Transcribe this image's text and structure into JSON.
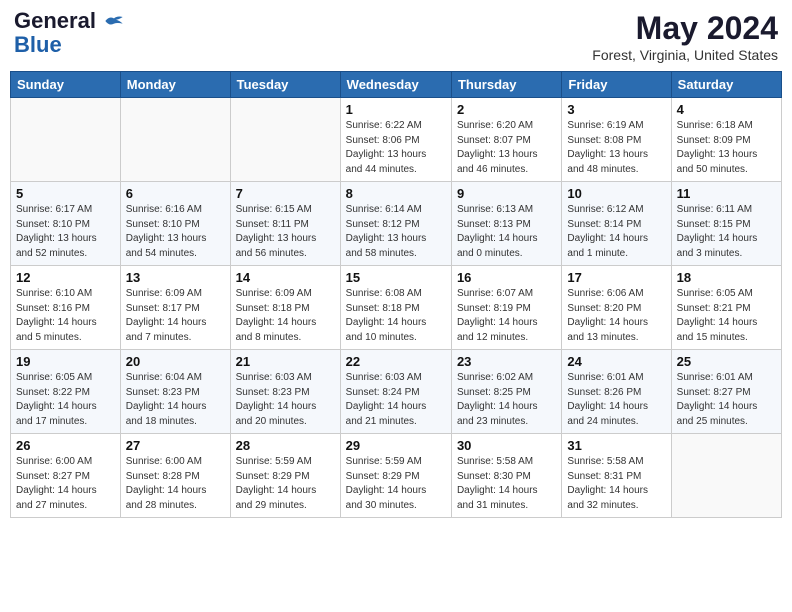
{
  "header": {
    "logo_line1": "General",
    "logo_line2": "Blue",
    "month_year": "May 2024",
    "location": "Forest, Virginia, United States"
  },
  "days_of_week": [
    "Sunday",
    "Monday",
    "Tuesday",
    "Wednesday",
    "Thursday",
    "Friday",
    "Saturday"
  ],
  "weeks": [
    [
      {
        "day": "",
        "info": ""
      },
      {
        "day": "",
        "info": ""
      },
      {
        "day": "",
        "info": ""
      },
      {
        "day": "1",
        "info": "Sunrise: 6:22 AM\nSunset: 8:06 PM\nDaylight: 13 hours\nand 44 minutes."
      },
      {
        "day": "2",
        "info": "Sunrise: 6:20 AM\nSunset: 8:07 PM\nDaylight: 13 hours\nand 46 minutes."
      },
      {
        "day": "3",
        "info": "Sunrise: 6:19 AM\nSunset: 8:08 PM\nDaylight: 13 hours\nand 48 minutes."
      },
      {
        "day": "4",
        "info": "Sunrise: 6:18 AM\nSunset: 8:09 PM\nDaylight: 13 hours\nand 50 minutes."
      }
    ],
    [
      {
        "day": "5",
        "info": "Sunrise: 6:17 AM\nSunset: 8:10 PM\nDaylight: 13 hours\nand 52 minutes."
      },
      {
        "day": "6",
        "info": "Sunrise: 6:16 AM\nSunset: 8:10 PM\nDaylight: 13 hours\nand 54 minutes."
      },
      {
        "day": "7",
        "info": "Sunrise: 6:15 AM\nSunset: 8:11 PM\nDaylight: 13 hours\nand 56 minutes."
      },
      {
        "day": "8",
        "info": "Sunrise: 6:14 AM\nSunset: 8:12 PM\nDaylight: 13 hours\nand 58 minutes."
      },
      {
        "day": "9",
        "info": "Sunrise: 6:13 AM\nSunset: 8:13 PM\nDaylight: 14 hours\nand 0 minutes."
      },
      {
        "day": "10",
        "info": "Sunrise: 6:12 AM\nSunset: 8:14 PM\nDaylight: 14 hours\nand 1 minute."
      },
      {
        "day": "11",
        "info": "Sunrise: 6:11 AM\nSunset: 8:15 PM\nDaylight: 14 hours\nand 3 minutes."
      }
    ],
    [
      {
        "day": "12",
        "info": "Sunrise: 6:10 AM\nSunset: 8:16 PM\nDaylight: 14 hours\nand 5 minutes."
      },
      {
        "day": "13",
        "info": "Sunrise: 6:09 AM\nSunset: 8:17 PM\nDaylight: 14 hours\nand 7 minutes."
      },
      {
        "day": "14",
        "info": "Sunrise: 6:09 AM\nSunset: 8:18 PM\nDaylight: 14 hours\nand 8 minutes."
      },
      {
        "day": "15",
        "info": "Sunrise: 6:08 AM\nSunset: 8:18 PM\nDaylight: 14 hours\nand 10 minutes."
      },
      {
        "day": "16",
        "info": "Sunrise: 6:07 AM\nSunset: 8:19 PM\nDaylight: 14 hours\nand 12 minutes."
      },
      {
        "day": "17",
        "info": "Sunrise: 6:06 AM\nSunset: 8:20 PM\nDaylight: 14 hours\nand 13 minutes."
      },
      {
        "day": "18",
        "info": "Sunrise: 6:05 AM\nSunset: 8:21 PM\nDaylight: 14 hours\nand 15 minutes."
      }
    ],
    [
      {
        "day": "19",
        "info": "Sunrise: 6:05 AM\nSunset: 8:22 PM\nDaylight: 14 hours\nand 17 minutes."
      },
      {
        "day": "20",
        "info": "Sunrise: 6:04 AM\nSunset: 8:23 PM\nDaylight: 14 hours\nand 18 minutes."
      },
      {
        "day": "21",
        "info": "Sunrise: 6:03 AM\nSunset: 8:23 PM\nDaylight: 14 hours\nand 20 minutes."
      },
      {
        "day": "22",
        "info": "Sunrise: 6:03 AM\nSunset: 8:24 PM\nDaylight: 14 hours\nand 21 minutes."
      },
      {
        "day": "23",
        "info": "Sunrise: 6:02 AM\nSunset: 8:25 PM\nDaylight: 14 hours\nand 23 minutes."
      },
      {
        "day": "24",
        "info": "Sunrise: 6:01 AM\nSunset: 8:26 PM\nDaylight: 14 hours\nand 24 minutes."
      },
      {
        "day": "25",
        "info": "Sunrise: 6:01 AM\nSunset: 8:27 PM\nDaylight: 14 hours\nand 25 minutes."
      }
    ],
    [
      {
        "day": "26",
        "info": "Sunrise: 6:00 AM\nSunset: 8:27 PM\nDaylight: 14 hours\nand 27 minutes."
      },
      {
        "day": "27",
        "info": "Sunrise: 6:00 AM\nSunset: 8:28 PM\nDaylight: 14 hours\nand 28 minutes."
      },
      {
        "day": "28",
        "info": "Sunrise: 5:59 AM\nSunset: 8:29 PM\nDaylight: 14 hours\nand 29 minutes."
      },
      {
        "day": "29",
        "info": "Sunrise: 5:59 AM\nSunset: 8:29 PM\nDaylight: 14 hours\nand 30 minutes."
      },
      {
        "day": "30",
        "info": "Sunrise: 5:58 AM\nSunset: 8:30 PM\nDaylight: 14 hours\nand 31 minutes."
      },
      {
        "day": "31",
        "info": "Sunrise: 5:58 AM\nSunset: 8:31 PM\nDaylight: 14 hours\nand 32 minutes."
      },
      {
        "day": "",
        "info": ""
      }
    ]
  ]
}
